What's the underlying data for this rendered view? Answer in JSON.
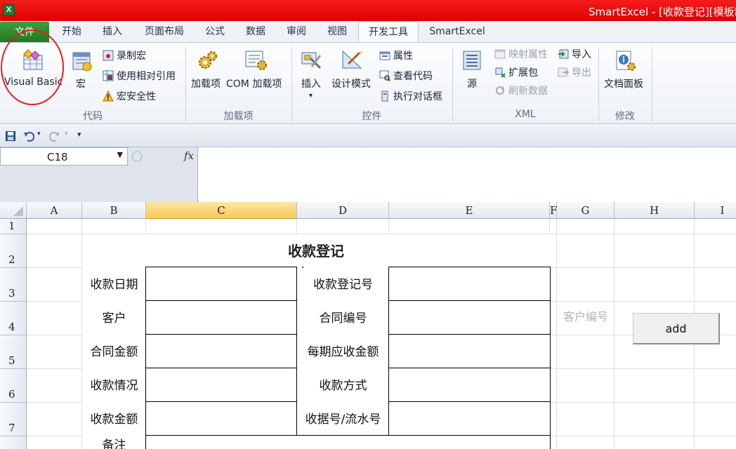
{
  "window": {
    "app_icon": "X",
    "title": "SmartExcel - [收款登记][模板制"
  },
  "tabs": [
    {
      "id": "file",
      "label": "文件"
    },
    {
      "id": "home",
      "label": "开始"
    },
    {
      "id": "insert",
      "label": "插入"
    },
    {
      "id": "page_layout",
      "label": "页面布局"
    },
    {
      "id": "formulas",
      "label": "公式"
    },
    {
      "id": "data",
      "label": "数据"
    },
    {
      "id": "review",
      "label": "审阅"
    },
    {
      "id": "view",
      "label": "视图"
    },
    {
      "id": "developer",
      "label": "开发工具",
      "active": true
    },
    {
      "id": "smartexcel",
      "label": "SmartExcel"
    }
  ],
  "ribbon": {
    "code": {
      "label": "代码",
      "visual_basic": "Visual Basic",
      "macros": "宏",
      "record_macro": "录制宏",
      "relative_ref": "使用相对引用",
      "macro_security": "宏安全性"
    },
    "addins": {
      "label": "加载项",
      "addins": "加载项",
      "com_addins": "COM 加载项"
    },
    "controls": {
      "label": "控件",
      "insert": "插入",
      "design_mode": "设计模式",
      "properties": "属性",
      "view_code": "查看代码",
      "run_dialog": "执行对话框"
    },
    "xml": {
      "label": "XML",
      "source": "源",
      "map_properties": "映射属性",
      "expansion_packs": "扩展包",
      "refresh_data": "刷新数据",
      "import": "导入",
      "export": "导出"
    },
    "modify": {
      "label": "修改",
      "document_panel": "文档面板"
    }
  },
  "formula_bar": {
    "name_box": "C18",
    "fx": "fx",
    "formula": ""
  },
  "sheet": {
    "columns": [
      "A",
      "B",
      "C",
      "D",
      "E",
      "F",
      "G",
      "H",
      "I"
    ],
    "rows": [
      "1",
      "2",
      "3",
      "4",
      "5",
      "6",
      "7"
    ],
    "title": "收款登记",
    "fields_left": [
      "收款日期",
      "客户",
      "合同金额",
      "收款情况",
      "收款金额",
      "备注"
    ],
    "fields_right": [
      "收款登记号",
      "合同编号",
      "每期应收金额",
      "收款方式",
      "收据号/流水号"
    ],
    "hint": "客户编号",
    "button_label": "add"
  },
  "colors": {
    "title_bar": "#e50000",
    "file_tab": "#2a8a2e",
    "selected_header": "#f8c959",
    "annotation_circle": "#e81b1b"
  }
}
